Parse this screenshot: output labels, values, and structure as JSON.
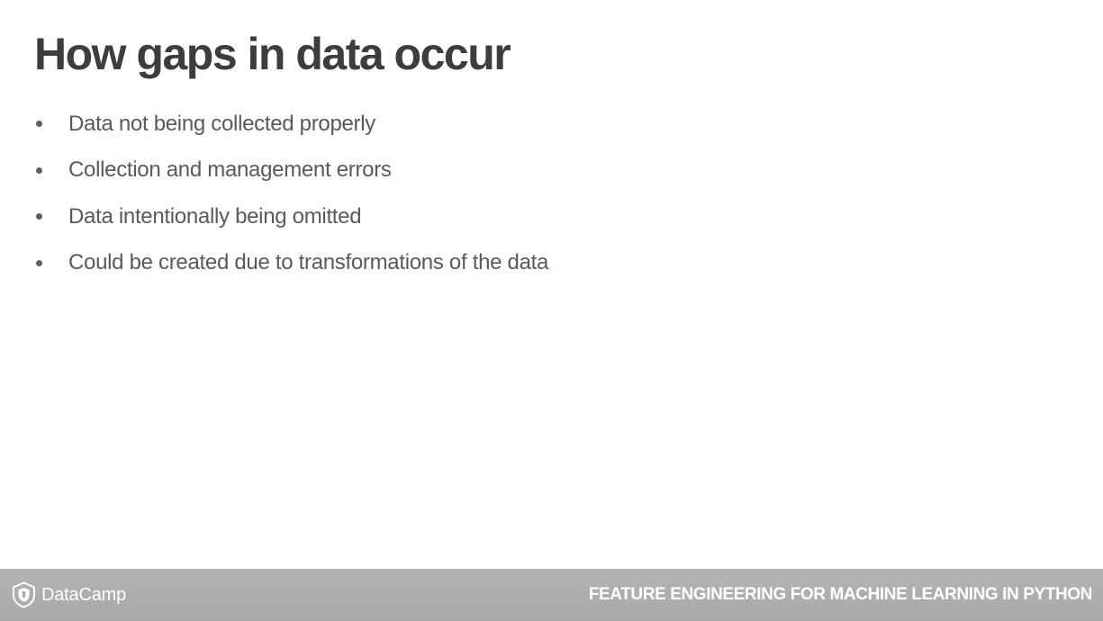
{
  "slide": {
    "title": "How gaps in data occur",
    "bullets": [
      "Data not being collected properly",
      "Collection and management errors",
      "Data intentionally being omitted",
      "Could be created due to transformations of the data"
    ]
  },
  "footer": {
    "logo_text": "DataCamp",
    "logo_icon": "datacamp-logo-icon",
    "course_title": "FEATURE ENGINEERING FOR MACHINE LEARNING IN PYTHON"
  },
  "colors": {
    "title": "#3d3d3d",
    "bullet_text": "#5a5a5a",
    "footer_bg": "#ababab",
    "footer_text": "#ffffff"
  }
}
